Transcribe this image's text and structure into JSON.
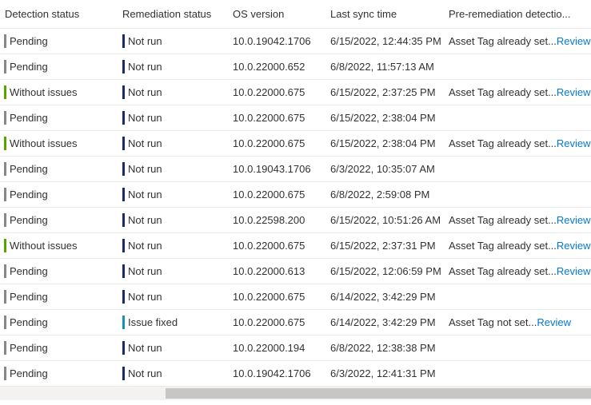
{
  "columns": [
    "Detection status",
    "Remediation status",
    "OS version",
    "Last sync time",
    "Pre-remediation detectio..."
  ],
  "colors": {
    "pending": "#8a8886",
    "without_issues": "#57a300",
    "not_run": "#1a2b6d",
    "issue_fixed": "#1c8fb5",
    "link": "#0078d4"
  },
  "rows": [
    {
      "detection": "Pending",
      "det_color": "grey",
      "remediation": "Not run",
      "rem_color": "navy",
      "os": "10.0.19042.1706",
      "sync": "6/15/2022, 12:44:35 PM",
      "pre": "Asset Tag already set...",
      "review": "Review"
    },
    {
      "detection": "Pending",
      "det_color": "grey",
      "remediation": "Not run",
      "rem_color": "navy",
      "os": "10.0.22000.652",
      "sync": "6/8/2022, 11:57:13 AM",
      "pre": "",
      "review": ""
    },
    {
      "detection": "Without issues",
      "det_color": "green",
      "remediation": "Not run",
      "rem_color": "navy",
      "os": "10.0.22000.675",
      "sync": "6/15/2022, 2:37:25 PM",
      "pre": "Asset Tag already set...",
      "review": "Review"
    },
    {
      "detection": "Pending",
      "det_color": "grey",
      "remediation": "Not run",
      "rem_color": "navy",
      "os": "10.0.22000.675",
      "sync": "6/15/2022, 2:38:04 PM",
      "pre": "",
      "review": ""
    },
    {
      "detection": "Without issues",
      "det_color": "green",
      "remediation": "Not run",
      "rem_color": "navy",
      "os": "10.0.22000.675",
      "sync": "6/15/2022, 2:38:04 PM",
      "pre": "Asset Tag already set...",
      "review": "Review"
    },
    {
      "detection": "Pending",
      "det_color": "grey",
      "remediation": "Not run",
      "rem_color": "navy",
      "os": "10.0.19043.1706",
      "sync": "6/3/2022, 10:35:07 AM",
      "pre": "",
      "review": ""
    },
    {
      "detection": "Pending",
      "det_color": "grey",
      "remediation": "Not run",
      "rem_color": "navy",
      "os": "10.0.22000.675",
      "sync": "6/8/2022, 2:59:08 PM",
      "pre": "",
      "review": ""
    },
    {
      "detection": "Pending",
      "det_color": "grey",
      "remediation": "Not run",
      "rem_color": "navy",
      "os": "10.0.22598.200",
      "sync": "6/15/2022, 10:51:26 AM",
      "pre": "Asset Tag already set...",
      "review": "Review"
    },
    {
      "detection": "Without issues",
      "det_color": "green",
      "remediation": "Not run",
      "rem_color": "navy",
      "os": "10.0.22000.675",
      "sync": "6/15/2022, 2:37:31 PM",
      "pre": "Asset Tag already set...",
      "review": "Review"
    },
    {
      "detection": "Pending",
      "det_color": "grey",
      "remediation": "Not run",
      "rem_color": "navy",
      "os": "10.0.22000.613",
      "sync": "6/15/2022, 12:06:59 PM",
      "pre": "Asset Tag already set...",
      "review": "Review"
    },
    {
      "detection": "Pending",
      "det_color": "grey",
      "remediation": "Not run",
      "rem_color": "navy",
      "os": "10.0.22000.675",
      "sync": "6/14/2022, 3:42:29 PM",
      "pre": "",
      "review": ""
    },
    {
      "detection": "Pending",
      "det_color": "grey",
      "remediation": "Issue fixed",
      "rem_color": "teal",
      "os": "10.0.22000.675",
      "sync": "6/14/2022, 3:42:29 PM",
      "pre": "Asset Tag not set...",
      "review": "Review"
    },
    {
      "detection": "Pending",
      "det_color": "grey",
      "remediation": "Not run",
      "rem_color": "navy",
      "os": "10.0.22000.194",
      "sync": "6/8/2022, 12:38:38 PM",
      "pre": "",
      "review": ""
    },
    {
      "detection": "Pending",
      "det_color": "grey",
      "remediation": "Not run",
      "rem_color": "navy",
      "os": "10.0.19042.1706",
      "sync": "6/3/2022, 12:41:31 PM",
      "pre": "",
      "review": ""
    }
  ]
}
